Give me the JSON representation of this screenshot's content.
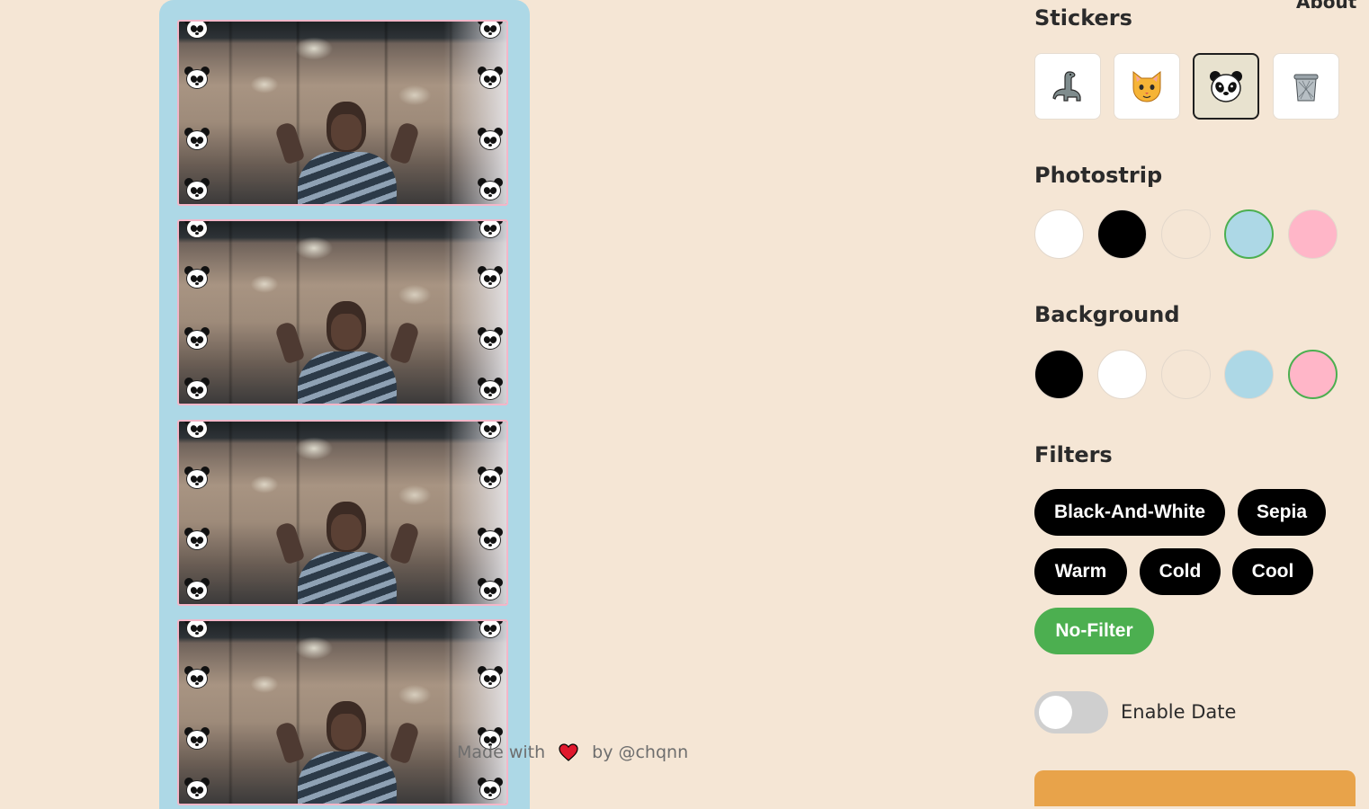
{
  "header": {
    "about_label": "About"
  },
  "panel": {
    "stickers": {
      "title": "Stickers",
      "items": [
        {
          "name": "dinosaur",
          "icon": "dinosaur-icon",
          "emoji": "🦕",
          "selected": false
        },
        {
          "name": "cat",
          "icon": "cat-face-icon",
          "emoji": "🐱",
          "selected": false
        },
        {
          "name": "panda",
          "icon": "panda-icon",
          "emoji": "🐼",
          "selected": true
        },
        {
          "name": "trash",
          "icon": "trash-icon",
          "emoji": "🗑",
          "selected": false
        }
      ]
    },
    "photostrip": {
      "title": "Photostrip",
      "colors": [
        {
          "value": "#ffffff",
          "selected": false
        },
        {
          "value": "#000000",
          "selected": false
        },
        {
          "value": "#f5e6d5",
          "selected": false
        },
        {
          "value": "#add8e6",
          "selected": true
        },
        {
          "value": "#ffb6c8",
          "selected": false
        }
      ]
    },
    "background": {
      "title": "Background",
      "colors": [
        {
          "value": "#000000",
          "selected": false
        },
        {
          "value": "#ffffff",
          "selected": false
        },
        {
          "value": "#f5e6d5",
          "selected": false
        },
        {
          "value": "#add8e6",
          "selected": false
        },
        {
          "value": "#ffb6c8",
          "selected": true
        }
      ]
    },
    "filters": {
      "title": "Filters",
      "items": [
        {
          "label": "Black-And-White",
          "active": false
        },
        {
          "label": "Sepia",
          "active": false
        },
        {
          "label": "Warm",
          "active": false
        },
        {
          "label": "Cold",
          "active": false
        },
        {
          "label": "Cool",
          "active": false
        },
        {
          "label": "No-Filter",
          "active": true
        }
      ]
    },
    "enable_date": {
      "label": "Enable Date",
      "on": false
    }
  },
  "strip": {
    "photo_count": 4,
    "sticker": "panda-icon",
    "frame_color": "#add8e6",
    "photo_border_color": "#ffb6c8"
  },
  "footer": {
    "made_with": "Made with",
    "heart_icon": "heart-icon",
    "by": "by @chqnn"
  },
  "colors": {
    "page_background": "#f5e6d5",
    "accent_green": "#4caf50",
    "pill_black": "#000000",
    "download_orange": "#e8a34a"
  }
}
